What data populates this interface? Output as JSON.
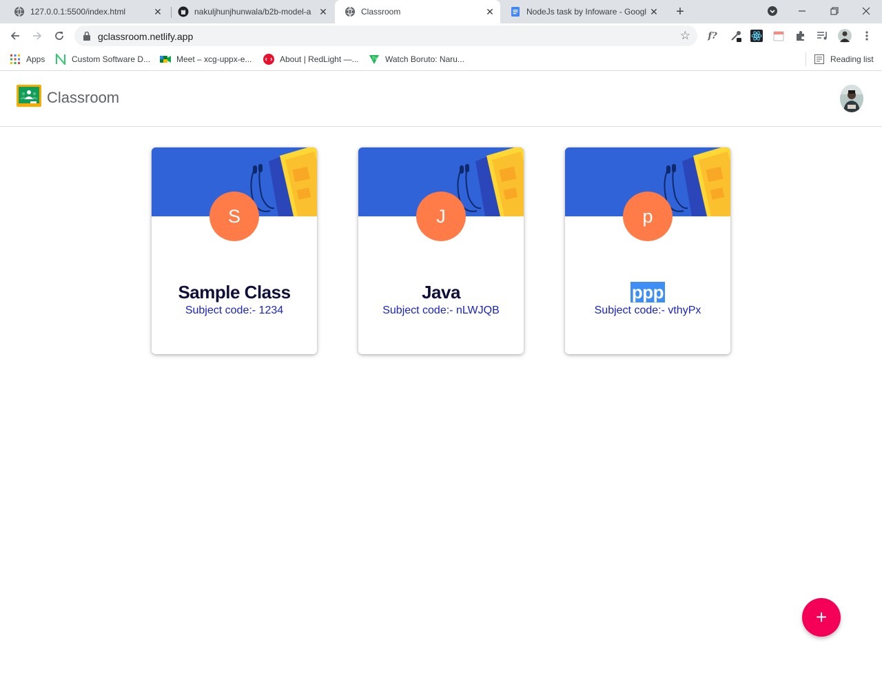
{
  "browser": {
    "tabs": [
      {
        "title": "127.0.0.1:5500/index.html",
        "icon": "globe-icon"
      },
      {
        "title": "nakuljhunjhunwala/b2b-model-a",
        "icon": "github-icon"
      },
      {
        "title": "Classroom",
        "icon": "globe-icon"
      },
      {
        "title": "NodeJs task by Infoware - Googl",
        "icon": "docs-icon"
      }
    ],
    "url": "gclassroom.netlify.app",
    "bookmarks": [
      {
        "label": "Apps",
        "icon": "apps-grid-icon"
      },
      {
        "label": "Custom Software D...",
        "icon": "n-logo-icon"
      },
      {
        "label": "Meet – xcg-uppx-e...",
        "icon": "meet-icon"
      },
      {
        "label": "About | RedLight —...",
        "icon": "redlight-icon"
      },
      {
        "label": "Watch Boruto: Naru...",
        "icon": "tv-icon"
      }
    ],
    "reading_list": "Reading list",
    "ext_f": "f?"
  },
  "app": {
    "title": "Classroom"
  },
  "classes": [
    {
      "initial": "S",
      "name": "Sample Class",
      "code": "Subject code:- 1234"
    },
    {
      "initial": "J",
      "name": "Java",
      "code": "Subject code:- nLWJQB"
    },
    {
      "initial": "p",
      "name": "ppp",
      "code": "Subject code:- vthyPx"
    }
  ],
  "fab": {
    "symbol": "+"
  },
  "colors": {
    "banner": "#3163d8",
    "initial_circle": "#ff7b47",
    "fab": "#f50057",
    "code_text": "#1a23c7"
  }
}
